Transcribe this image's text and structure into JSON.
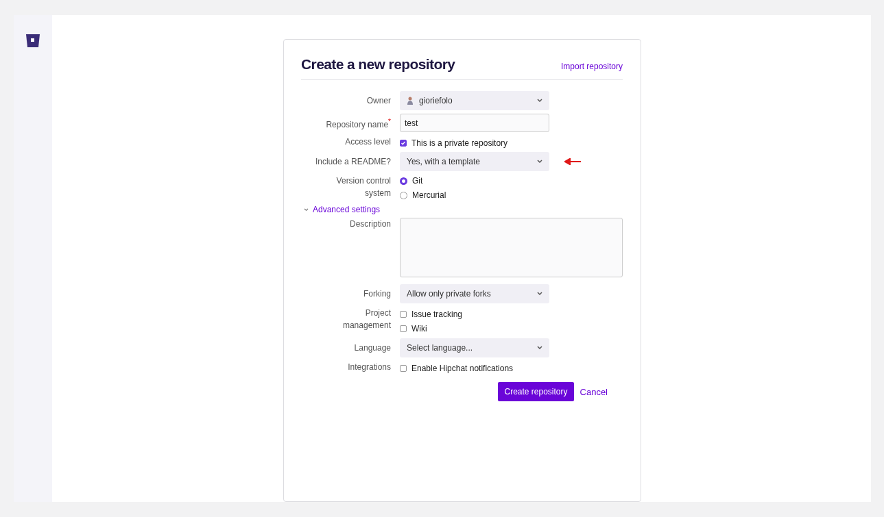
{
  "title": "Create a new repository",
  "import_link": "Import repository",
  "fields": [
    {
      "kind": "select",
      "label": "Owner",
      "value": "gioriefolo",
      "avatar": true
    },
    {
      "kind": "text",
      "label": "Repository name",
      "required_mark": "*",
      "value": "test"
    },
    {
      "kind": "checks",
      "label": "Access level",
      "options": [
        {
          "label": "This is a private repository",
          "checked": true
        }
      ]
    },
    {
      "kind": "select",
      "label": "Include a README?",
      "value": "Yes, with a template",
      "annotated": true
    },
    {
      "kind": "radios",
      "label": "Version control\nsystem",
      "options": [
        {
          "label": "Git",
          "selected": true
        },
        {
          "label": "Mercurial",
          "selected": false
        }
      ]
    },
    {
      "kind": "toggle",
      "label": "Advanced settings",
      "expanded": true
    },
    {
      "kind": "textarea",
      "label": "Description"
    },
    {
      "kind": "select",
      "label": "Forking",
      "value": "Allow only private forks"
    },
    {
      "kind": "checks",
      "label": "Project\nmanagement",
      "options": [
        {
          "label": "Issue tracking",
          "checked": false
        },
        {
          "label": "Wiki",
          "checked": false
        }
      ]
    },
    {
      "kind": "select",
      "label": "Language",
      "value": "Select language..."
    },
    {
      "kind": "checks",
      "label": "Integrations",
      "options": [
        {
          "label": "Enable Hipchat notifications",
          "checked": false
        }
      ]
    }
  ],
  "buttons": {
    "primary": "Create repository",
    "cancel": "Cancel"
  }
}
